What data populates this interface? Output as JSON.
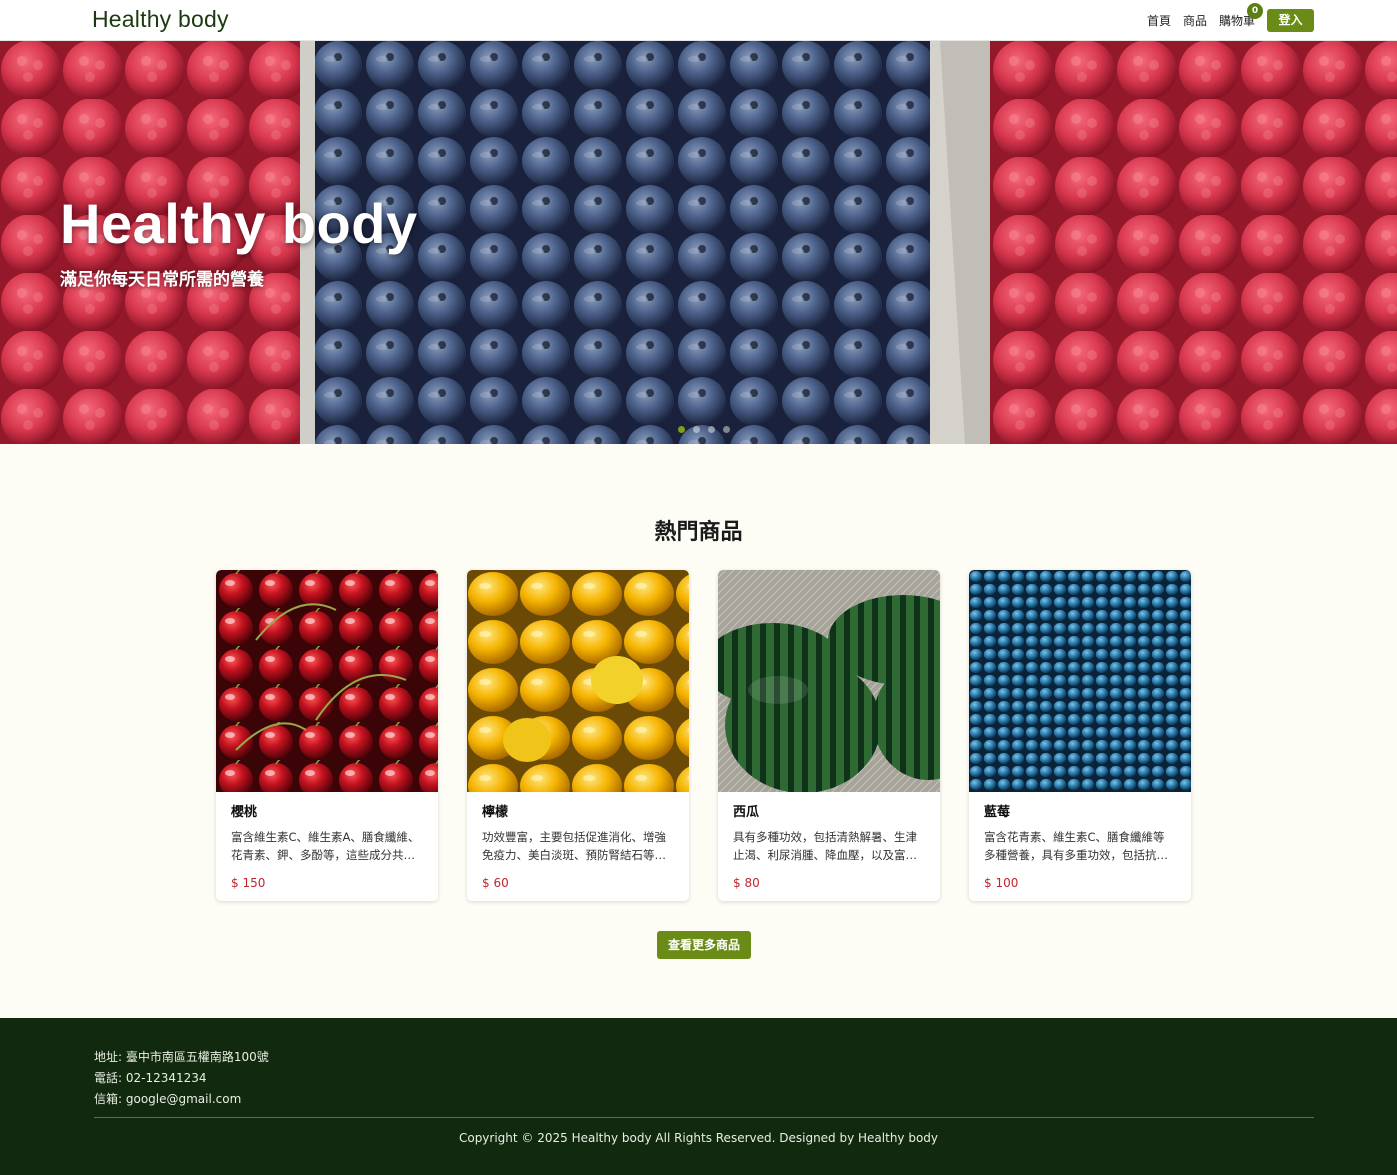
{
  "nav": {
    "brand": "Healthy body",
    "links": [
      "首頁",
      "商品",
      "購物車"
    ],
    "cart_count": "0",
    "login_label": "登入"
  },
  "hero": {
    "title": "Healthy body",
    "subtitle": "滿足你每天日常所需的營養",
    "slides": 4,
    "active_slide": 0
  },
  "section": {
    "title": "熱門商品",
    "products": [
      {
        "name": "櫻桃",
        "desc": "富含維生素C、維生素A、膳食纖維、花青素、鉀、多酚等，這些成分共同作用有助於健康",
        "price": "$ 150",
        "image": "cherries"
      },
      {
        "name": "檸檬",
        "desc": "功效豐富，主要包括促進消化、增強免疫力、美白淡斑、預防腎結石等功效",
        "price": "$ 60",
        "image": "lemons"
      },
      {
        "name": "西瓜",
        "desc": "具有多種功效，包括清熱解暑、生津止渴、利尿消腫、降血壓，以及富含水分",
        "price": "$ 80",
        "image": "watermelons"
      },
      {
        "name": "藍莓",
        "desc": "富含花青素、維生素C、膳食纖維等多種營養，具有多重功效，包括抗氧化作用",
        "price": "$ 100",
        "image": "blueberries"
      }
    ],
    "more_label": "查看更多商品"
  },
  "footer": {
    "address": "地址: 臺中市南區五權南路100號",
    "phone": "電話: 02-12341234",
    "email": "信箱: google@gmail.com",
    "copyright": "Copyright © 2025 Healthy body All Rights Reserved. Designed by Healthy body"
  },
  "colors": {
    "brand": "#1b3a12",
    "accent": "#6a8b15",
    "price": "#c0262c",
    "footer_bg": "#11290f",
    "page_bg": "#fdfdf5"
  }
}
